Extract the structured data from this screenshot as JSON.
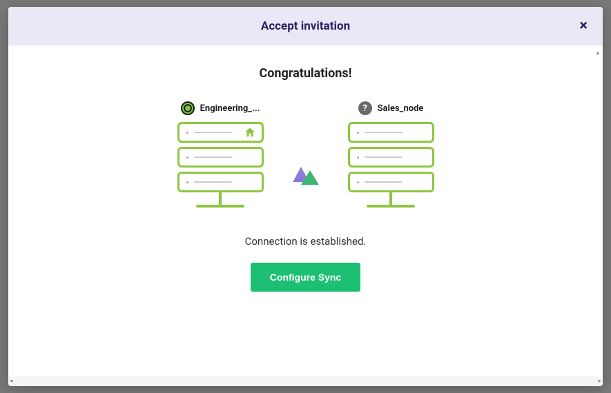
{
  "modal": {
    "title": "Accept invitation",
    "congrats": "Congratulations!",
    "left_node": {
      "name": "Engineering_..."
    },
    "right_node": {
      "name": "Sales_node"
    },
    "status": "Connection is established.",
    "button_label": "Configure Sync"
  }
}
